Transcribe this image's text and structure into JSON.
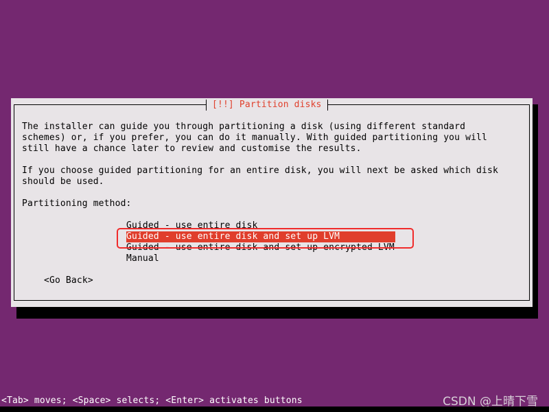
{
  "dialog": {
    "title": "[!!] Partition disks",
    "paragraph1": [
      "The installer can guide you through partitioning a disk (using different standard",
      "schemes) or, if you prefer, you can do it manually. With guided partitioning you will",
      "still have a chance later to review and customise the results."
    ],
    "paragraph2": [
      "If you choose guided partitioning for an entire disk, you will next be asked which disk",
      "should be used."
    ],
    "method_label": "Partitioning method:",
    "options": [
      "Guided - use entire disk",
      "Guided - use entire disk and set up LVM",
      "Guided - use entire disk and set up encrypted LVM",
      "Manual"
    ],
    "selected_option": "Guided - use entire disk and set up LVM",
    "go_back": "<Go Back>"
  },
  "status_bar": "<Tab> moves; <Space> selects; <Enter> activates buttons",
  "watermark": "CSDN @上晴下雪",
  "colors": {
    "background": "#742870",
    "dialog": "#e8e4e7",
    "highlight": "#e03e2c",
    "annotation": "#f02a2a"
  }
}
